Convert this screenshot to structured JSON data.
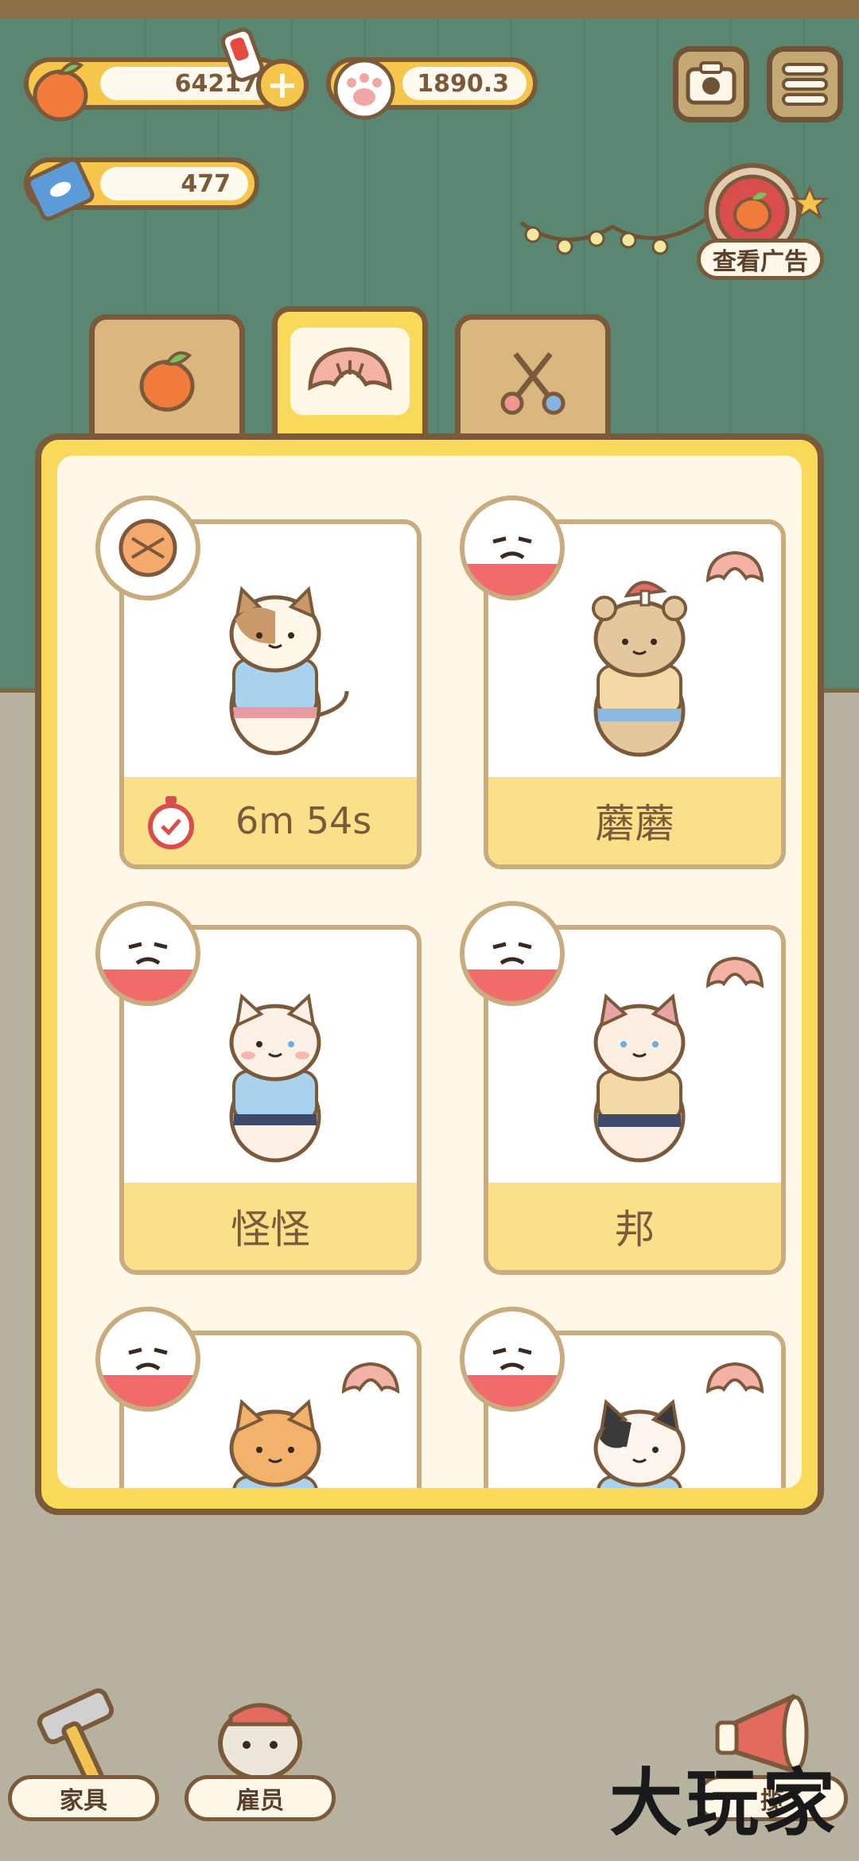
{
  "resources": {
    "apples": "64217",
    "paws": "1890.3",
    "tickets": "477"
  },
  "ad_button": {
    "label": "查看广告"
  },
  "tabs": [
    {
      "id": "apple",
      "icon": "apple-icon"
    },
    {
      "id": "bread",
      "icon": "bread-icon",
      "active": true
    },
    {
      "id": "scissors",
      "icon": "scissors-icon"
    }
  ],
  "cats": [
    {
      "footer": "6m 54s",
      "mood": "bread",
      "has_timer": true
    },
    {
      "footer": "蘑蘑",
      "mood": "sad",
      "mood_fill": 0.3
    },
    {
      "footer": "怪怪",
      "mood": "sad",
      "mood_fill": 0.3
    },
    {
      "footer": "邦",
      "mood": "sad",
      "mood_fill": 0.3
    },
    {
      "footer": "",
      "mood": "sad",
      "mood_fill": 0.3
    },
    {
      "footer": "",
      "mood": "sad",
      "mood_fill": 0.3
    }
  ],
  "bottom_nav": {
    "furniture": "家具",
    "staff": "雇员",
    "third": "揽"
  },
  "watermark": "大玩家",
  "colors": {
    "panel_yellow": "#f9d95a",
    "outline_brown": "#7b5a3c",
    "mood_red": "#f26b6b"
  }
}
